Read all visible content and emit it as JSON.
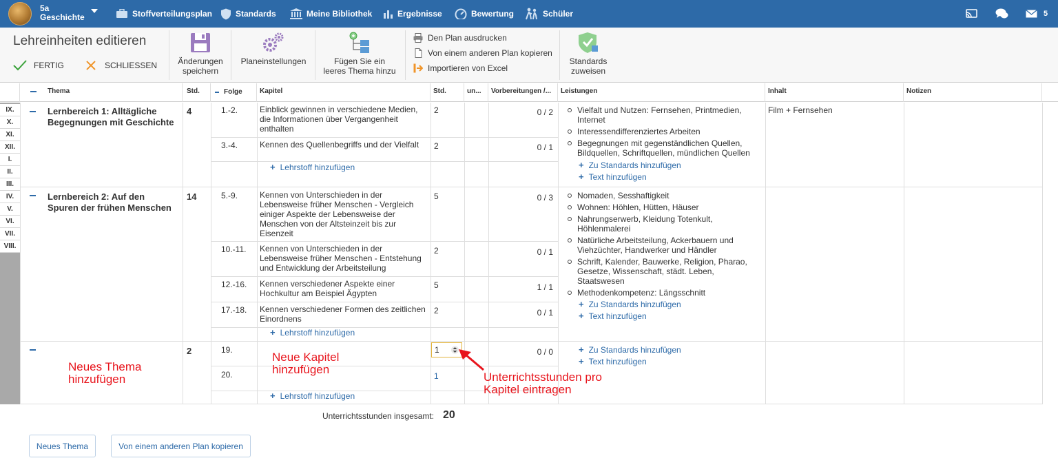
{
  "topbar": {
    "class_name": "5a",
    "subject": "Geschichte",
    "nav": [
      {
        "label": "Stoffverteilungsplan",
        "icon": "briefcase-icon"
      },
      {
        "label": "Standards",
        "icon": "shield-icon"
      },
      {
        "label": "Meine Bibliothek",
        "icon": "library-icon"
      },
      {
        "label": "Ergebnisse",
        "icon": "bar-chart-icon"
      },
      {
        "label": "Bewertung",
        "icon": "speedometer-icon"
      },
      {
        "label": "Schüler",
        "icon": "students-icon"
      }
    ],
    "mail_count": "5"
  },
  "toolbar": {
    "title": "Lehreinheiten editieren",
    "fertig": "FERTIG",
    "schliessen": "SCHLIESSEN",
    "save_line1": "Änderungen",
    "save_line2": "speichern",
    "plan_settings": "Planeinstellungen",
    "add_topic_line1": "Fügen Sie ein",
    "add_topic_line2": "leeres Thema hinzu",
    "print": "Den Plan ausdrucken",
    "copy": "Von einem anderen Plan kopieren",
    "import": "Importieren von Excel",
    "standards_line1": "Standards",
    "standards_line2": "zuweisen"
  },
  "table": {
    "headers": {
      "thema": "Thema",
      "std": "Std.",
      "folge": "Folge",
      "kapitel": "Kapitel",
      "std2": "Std.",
      "un": "un...",
      "vorbereitungen": "Vorbereitungen /...",
      "leistungen": "Leistungen",
      "inhalt": "Inhalt",
      "notizen": "Notizen"
    },
    "months": [
      "IX.",
      "X.",
      "XI.",
      "XII.",
      "I.",
      "II.",
      "III.",
      "IV.",
      "V.",
      "VI.",
      "VII.",
      "VIII."
    ],
    "topic1": {
      "title": "Lernbereich 1: Alltägliche Begegnungen mit Geschichte",
      "hours": "4",
      "rows": [
        {
          "folge": "1.-2.",
          "kapitel": "Einblick gewinnen in verschiedene Medien, die Informationen über Vergangenheit enthalten",
          "std": "2",
          "ratio": "0 / 2"
        },
        {
          "folge": "3.-4.",
          "kapitel": "Kennen des Quellenbegriffs und der Vielfalt",
          "std": "2",
          "ratio": "0 / 1"
        }
      ],
      "add_lehrstoff": "Lehrstoff hinzufügen",
      "leistungen": [
        "Vielfalt und Nutzen: Fernsehen, Printmedien, Internet",
        "Interessendifferenziertes Arbeiten",
        "Begegnungen mit gegenständlichen Quellen, Bildquellen, Schriftquellen, mündlichen Quellen"
      ],
      "add_standards": "Zu Standards hinzufügen",
      "add_text": "Text hinzufügen",
      "inhalt": "Film + Fernsehen"
    },
    "topic2": {
      "title": "Lernbereich 2: Auf den Spuren der frühen Menschen",
      "hours": "14",
      "rows": [
        {
          "folge": "5.-9.",
          "kapitel": "Kennen von Unterschieden in der Lebensweise früher Menschen - Vergleich einiger Aspekte der Lebensweise der Menschen von der Altsteinzeit bis zur Eisenzeit",
          "std": "5",
          "ratio": "0 / 3"
        },
        {
          "folge": "10.-11.",
          "kapitel": "Kennen von Unterschieden in der Lebensweise früher Menschen - Entstehung und Entwicklung der Arbeitsteilung",
          "std": "2",
          "ratio": "0 / 1"
        },
        {
          "folge": "12.-16.",
          "kapitel": "Kennen verschiedener Aspekte einer Hochkultur am Beispiel Ägypten",
          "std": "5",
          "ratio": "1 / 1"
        },
        {
          "folge": "17.-18.",
          "kapitel": "Kennen verschiedener Formen des zeitlichen Einordnens",
          "std": "2",
          "ratio": "0 / 1"
        }
      ],
      "add_lehrstoff": "Lehrstoff hinzufügen",
      "leistungen": [
        "Nomaden, Sesshaftigkeit",
        "Wohnen: Höhlen, Hütten, Häuser",
        "Nahrungserwerb, Kleidung Totenkult, Höhlenmalerei",
        "Natürliche Arbeitsteilung, Ackerbauern und Viehzüchter, Handwerker und Händler",
        "Schrift, Kalender, Bauwerke, Religion, Pharao, Gesetze, Wissenschaft, städt. Leben, Staatswesen",
        "Methodenkompetenz: Längsschnitt"
      ],
      "add_standards": "Zu Standards hinzufügen",
      "add_text": "Text hinzufügen"
    },
    "topic3": {
      "hours": "2",
      "rows": [
        {
          "folge": "19.",
          "std": "1",
          "ratio": "0 / 0"
        },
        {
          "folge": "20.",
          "std": "1"
        }
      ],
      "add_lehrstoff": "Lehrstoff hinzufügen",
      "add_standards": "Zu Standards hinzufügen",
      "add_text": "Text hinzufügen"
    }
  },
  "annotations": {
    "neues_thema_1": "Neues Thema",
    "neues_thema_2": "hinzufügen",
    "neue_kapitel_1": "Neue Kapitel",
    "neue_kapitel_2": "hinzufügen",
    "stunden_1": "Unterrichtsstunden pro",
    "stunden_2": "Kapitel eintragen"
  },
  "footer": {
    "total_label": "Unterrichtsstunden insgesamt:",
    "total_value": "20",
    "new_topic": "Neues Thema",
    "copy_plan": "Von einem anderen Plan kopieren"
  },
  "colors": {
    "brand_blue": "#2d6aa8",
    "annotation_red": "#e8141c",
    "stepper_border": "#e2b33c"
  }
}
